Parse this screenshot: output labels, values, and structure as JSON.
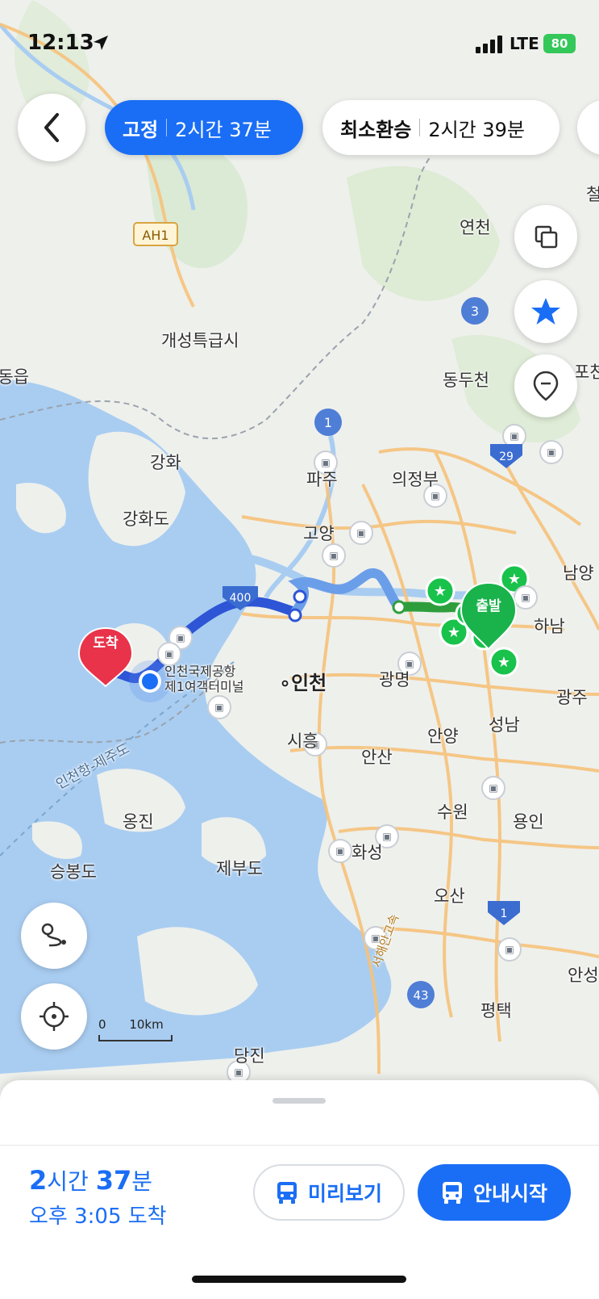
{
  "status_bar": {
    "time": "12:13",
    "network": "LTE",
    "battery": "80"
  },
  "route_options": [
    {
      "name": "고정",
      "time": "2시간 37분",
      "selected": true
    },
    {
      "name": "최소환승",
      "time": "2시간 39분",
      "selected": false
    }
  ],
  "map": {
    "places": {
      "yeoncheon": "연천",
      "kaesong": "개성특급시",
      "dongducheon": "동두천",
      "ganghwa": "강화",
      "ganghwado": "강화도",
      "paju": "파주",
      "uijeongbu": "의정부",
      "goyang": "고양",
      "incheon": "인천",
      "gwangmyeong": "광명",
      "anyang": "안양",
      "seongnam": "성남",
      "hanam": "하남",
      "namyang": "남양",
      "gwangju": "광주",
      "siheung": "시흥",
      "ansan": "안산",
      "suwon": "수원",
      "yongin": "용인",
      "ongjin": "옹진",
      "seungbongdo": "승봉도",
      "jebudo": "제부도",
      "hwaseong": "화성",
      "osan": "오산",
      "pyeongtaek": "평택",
      "anseong": "안성",
      "dangjin": "당진",
      "gyodong": "교동읍",
      "cheorwon": "철원",
      "pocheon": "포천"
    },
    "airport_line1": "인천국제공항",
    "airport_line2": "제1여객터미널",
    "ferry_route": "인천항-제주도",
    "expressway": "서해안고속",
    "road_badges": {
      "ah1": "AH1",
      "r3": "3",
      "r1": "1",
      "r29": "29",
      "r400": "400",
      "r1b": "1",
      "r43": "43"
    },
    "start_marker": "출발",
    "end_marker": "도착",
    "scale_zero": "0",
    "scale_distance": "10km"
  },
  "bottom_sheet": {
    "duration_hours": "2",
    "duration_hour_unit": "시간",
    "duration_minutes": "37",
    "duration_minute_unit": "분",
    "arrival": "오후 3:05 도착",
    "preview_label": "미리보기",
    "start_label": "안내시작"
  },
  "colors": {
    "accent": "#1a6ef5",
    "start_green": "#19c24b",
    "end_red": "#e8334a",
    "sea": "#aacdf0",
    "land": "#ecefe9"
  }
}
